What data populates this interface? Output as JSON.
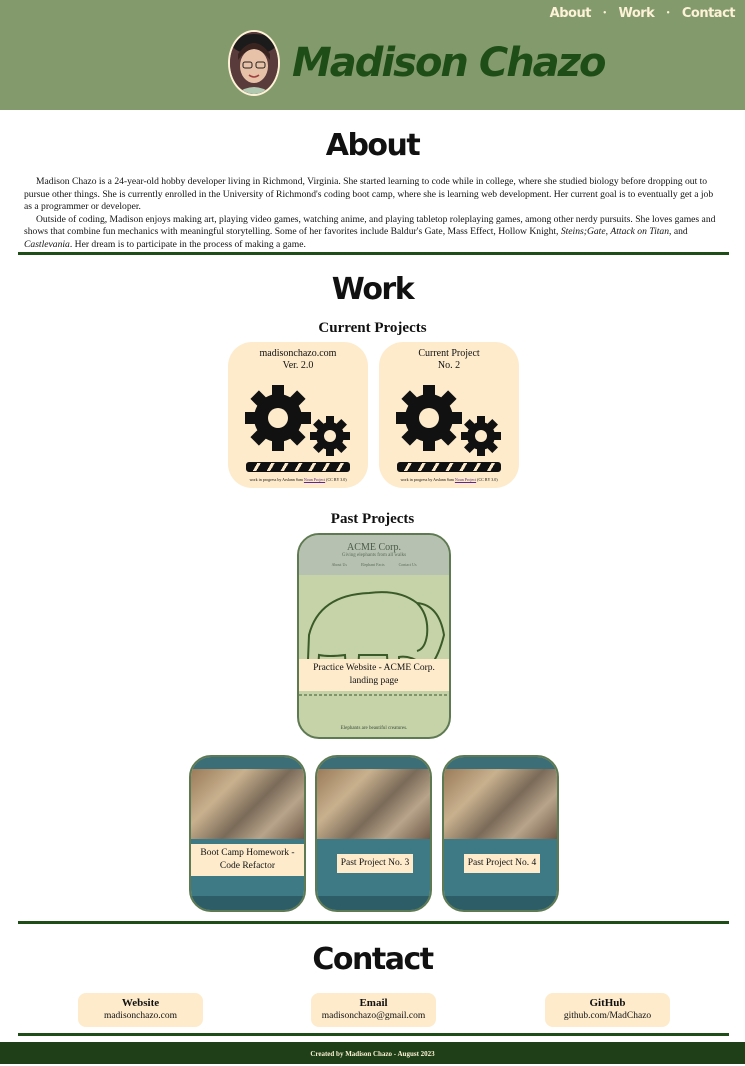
{
  "nav": {
    "items": [
      "About",
      "Work",
      "Contact"
    ]
  },
  "header": {
    "title": "Madison Chazo"
  },
  "about": {
    "heading": "About",
    "paragraph1": "Madison Chazo is a 24-year-old hobby developer living in Richmond, Virginia. She started learning to code while in college, where she studied biology before dropping out to pursue other things. She is currently enrolled in the University of Richmond's coding boot camp, where she is learning web development. Her current goal is to eventually get a job as a programmer or developer.",
    "paragraph2_start": "Outside of coding, Madison enjoys making art, playing video games, watching anime, and playing tabletop roleplaying games, among other nerdy pursuits. She loves games and shows that combine fun mechanics with meaningful storytelling. Some of her favorites include Baldur's Gate, Mass Effect, Hollow Knight, ",
    "italic1": "Steins;Gate",
    "sep1": ", ",
    "italic2": "Attack on Titan",
    "sep2": ", and ",
    "italic3": "Castlevania",
    "paragraph2_end": ". Her dream is to participate in the process of making a game."
  },
  "work": {
    "heading": "Work",
    "current_heading": "Current Projects",
    "current": [
      {
        "line1": "madisonchazo.com",
        "line2": "Ver. 2.0",
        "credit_text": "work in progress by Arslann Sam ",
        "credit_link": "Noun Project",
        "credit_license": " (CC BY 3.0)"
      },
      {
        "line1": "Current Project",
        "line2": "No. 2",
        "credit_text": "work in progress by Arslann Sam ",
        "credit_link": "Noun Project",
        "credit_license": " (CC BY 3.0)"
      }
    ],
    "past_heading": "Past Projects",
    "featured": {
      "label": "Practice Website - ACME Corp. landing page",
      "ss_title": "ACME Corp.",
      "ss_tagline": "Giving elephants from all walks",
      "ss_nav": [
        "About Us",
        "Elephant Facts",
        "Contact Us"
      ],
      "ss_caption": "Elephants are beautiful creatures."
    },
    "past": [
      {
        "label": "Boot Camp Homework - Code Refactor"
      },
      {
        "label": "Past Project No. 3"
      },
      {
        "label": "Past Project No. 4"
      }
    ]
  },
  "contact": {
    "heading": "Contact",
    "items": [
      {
        "key": "Website",
        "value": "madisonchazo.com"
      },
      {
        "key": "Email",
        "value": "madisonchazo@gmail.com"
      },
      {
        "key": "GitHub",
        "value": "github.com/MadChazo"
      }
    ]
  },
  "footer": {
    "text": "Created by Madison Chazo - August 2023"
  },
  "colors": {
    "header_bg": "#839a6d",
    "title": "#1e4d17",
    "card_bg": "#fdebcc",
    "rule": "#1e4d17",
    "footer_bg": "#1e3f17"
  },
  "icons": [
    "gears-icon",
    "progress-bar-icon",
    "avatar"
  ]
}
